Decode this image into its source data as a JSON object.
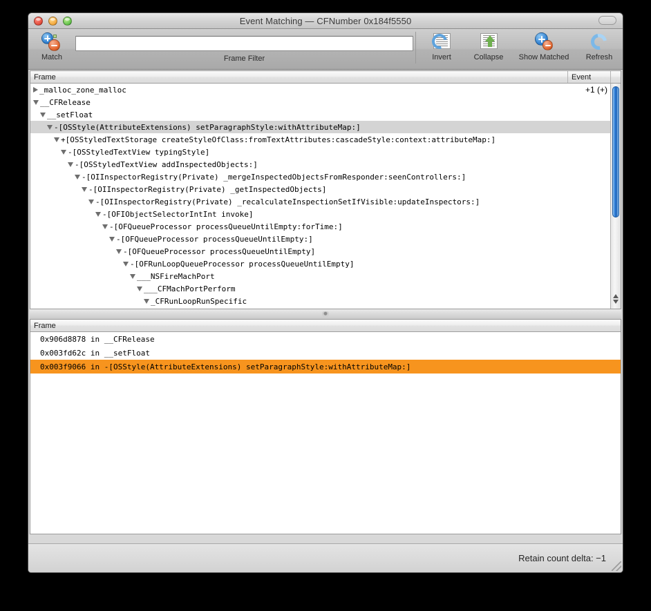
{
  "window": {
    "title": "Event Matching — CFNumber 0x184f5550",
    "traffic": {
      "close": "close-button",
      "minimize": "minimize-button",
      "zoom": "zoom-button"
    }
  },
  "toolbar": {
    "match": {
      "label": "Match",
      "icon": "add-remove-match-icon"
    },
    "filter": {
      "label": "Frame Filter",
      "value": "",
      "placeholder": ""
    },
    "items": [
      {
        "label": "Invert",
        "icon": "invert-icon"
      },
      {
        "label": "Collapse",
        "icon": "collapse-icon"
      },
      {
        "label": "Show Matched",
        "icon": "show-matched-icon"
      },
      {
        "label": "Refresh",
        "icon": "refresh-icon"
      }
    ]
  },
  "tree": {
    "columns": {
      "frame": "Frame",
      "event": "Event"
    },
    "rows": [
      {
        "indent": 0,
        "disclosure": "closed",
        "label": "_malloc_zone_malloc",
        "event": "+1 (+)",
        "selected": false
      },
      {
        "indent": 0,
        "disclosure": "open",
        "label": "__CFRelease",
        "event": "",
        "selected": false
      },
      {
        "indent": 1,
        "disclosure": "open",
        "label": "__setFloat",
        "event": "",
        "selected": false
      },
      {
        "indent": 2,
        "disclosure": "open",
        "label": "-[OSStyle(AttributeExtensions) setParagraphStyle:withAttributeMap:]",
        "event": "",
        "selected": true
      },
      {
        "indent": 3,
        "disclosure": "open",
        "label": "+[OSStyledTextStorage createStyleOfClass:fromTextAttributes:cascadeStyle:context:attributeMap:]",
        "event": "",
        "selected": false
      },
      {
        "indent": 4,
        "disclosure": "open",
        "label": "-[OSStyledTextView typingStyle]",
        "event": "",
        "selected": false
      },
      {
        "indent": 5,
        "disclosure": "open",
        "label": "-[OSStyledTextView addInspectedObjects:]",
        "event": "",
        "selected": false
      },
      {
        "indent": 6,
        "disclosure": "open",
        "label": "-[OIInspectorRegistry(Private) _mergeInspectedObjectsFromResponder:seenControllers:]",
        "event": "",
        "selected": false
      },
      {
        "indent": 7,
        "disclosure": "open",
        "label": "-[OIInspectorRegistry(Private) _getInspectedObjects]",
        "event": "",
        "selected": false
      },
      {
        "indent": 8,
        "disclosure": "open",
        "label": "-[OIInspectorRegistry(Private) _recalculateInspectionSetIfVisible:updateInspectors:]",
        "event": "",
        "selected": false
      },
      {
        "indent": 9,
        "disclosure": "open",
        "label": "-[OFIObjectSelectorIntInt invoke]",
        "event": "",
        "selected": false
      },
      {
        "indent": 10,
        "disclosure": "open",
        "label": "-[OFQueueProcessor processQueueUntilEmpty:forTime:]",
        "event": "",
        "selected": false
      },
      {
        "indent": 11,
        "disclosure": "open",
        "label": "-[OFQueueProcessor processQueueUntilEmpty:]",
        "event": "",
        "selected": false
      },
      {
        "indent": 12,
        "disclosure": "open",
        "label": "-[OFQueueProcessor processQueueUntilEmpty]",
        "event": "",
        "selected": false
      },
      {
        "indent": 13,
        "disclosure": "open",
        "label": "-[OFRunLoopQueueProcessor processQueueUntilEmpty]",
        "event": "",
        "selected": false
      },
      {
        "indent": 14,
        "disclosure": "open",
        "label": "___NSFireMachPort",
        "event": "",
        "selected": false
      },
      {
        "indent": 15,
        "disclosure": "open",
        "label": "___CFMachPortPerform",
        "event": "",
        "selected": false
      },
      {
        "indent": 16,
        "disclosure": "open",
        "label": "_CFRunLoopRunSpecific",
        "event": "",
        "selected": false
      }
    ]
  },
  "list": {
    "columns": {
      "frame": "Frame"
    },
    "rows": [
      {
        "label": "0x906d8878 in __CFRelease",
        "selected": false
      },
      {
        "label": "0x003fd62c in __setFloat",
        "selected": false
      },
      {
        "label": "0x003f9066 in -[OSStyle(AttributeExtensions) setParagraphStyle:withAttributeMap:]",
        "selected": true
      }
    ]
  },
  "status": {
    "text": "Retain count delta: −1"
  },
  "colors": {
    "selection_orange": "#f7941e",
    "row_selected_gray": "#d4d4d4",
    "scrollbar_blue": "#2f7fd8"
  }
}
